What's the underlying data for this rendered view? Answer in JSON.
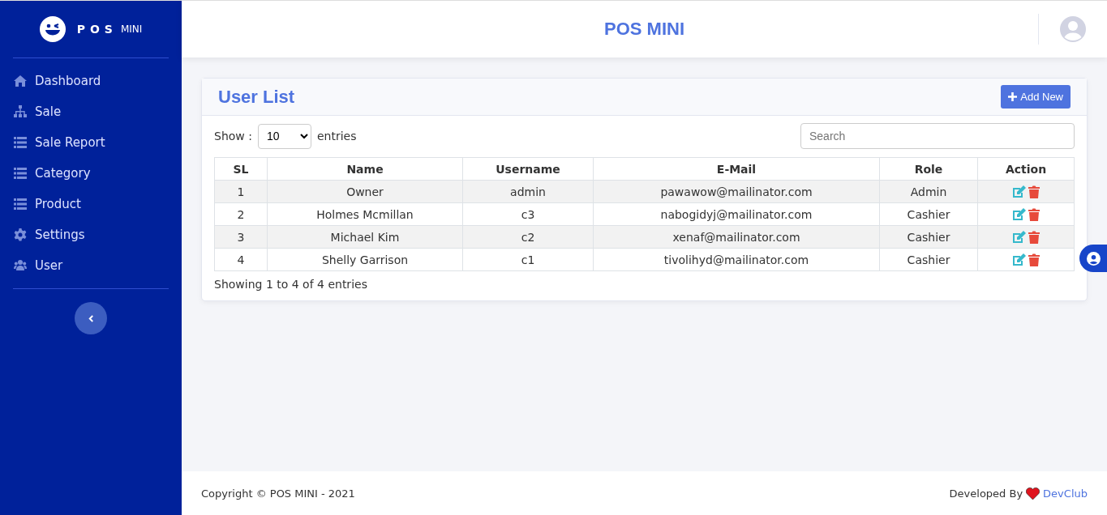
{
  "sidebar": {
    "logo": {
      "brand": "POS",
      "suffix": "MINI"
    },
    "items": [
      {
        "label": "Dashboard",
        "kind": "home"
      },
      {
        "label": "Sale",
        "kind": "sitemap"
      },
      {
        "label": "Sale Report",
        "kind": "list"
      },
      {
        "label": "Category",
        "kind": "list"
      },
      {
        "label": "Product",
        "kind": "list"
      },
      {
        "label": "Settings",
        "kind": "gear"
      },
      {
        "label": "User",
        "kind": "users"
      }
    ]
  },
  "header": {
    "title": "POS MINI"
  },
  "card": {
    "title": "User List",
    "add_button": "Add New",
    "show_label": "Show :",
    "page_size": "10",
    "entries_label": "entries",
    "search": {
      "placeholder": "Search"
    },
    "table": {
      "columns": [
        "SL",
        "Name",
        "Username",
        "E-Mail",
        "Role",
        "Action"
      ],
      "rows": [
        [
          "1",
          "Owner",
          "admin",
          "pawawow@mailinator.com",
          "Admin"
        ],
        [
          "2",
          "Holmes Mcmillan",
          "c3",
          "nabogidyj@mailinator.com",
          "Cashier"
        ],
        [
          "3",
          "Michael Kim",
          "c2",
          "xenaf@mailinator.com",
          "Cashier"
        ],
        [
          "4",
          "Shelly Garrison",
          "c1",
          "tivolihyd@mailinator.com",
          "Cashier"
        ]
      ]
    },
    "info": "Showing 1 to 4 of 4 entries"
  },
  "footer": {
    "copyright": "Copyright © POS MINI - 2021",
    "developed_by": "Developed By",
    "link": "DevClub"
  }
}
